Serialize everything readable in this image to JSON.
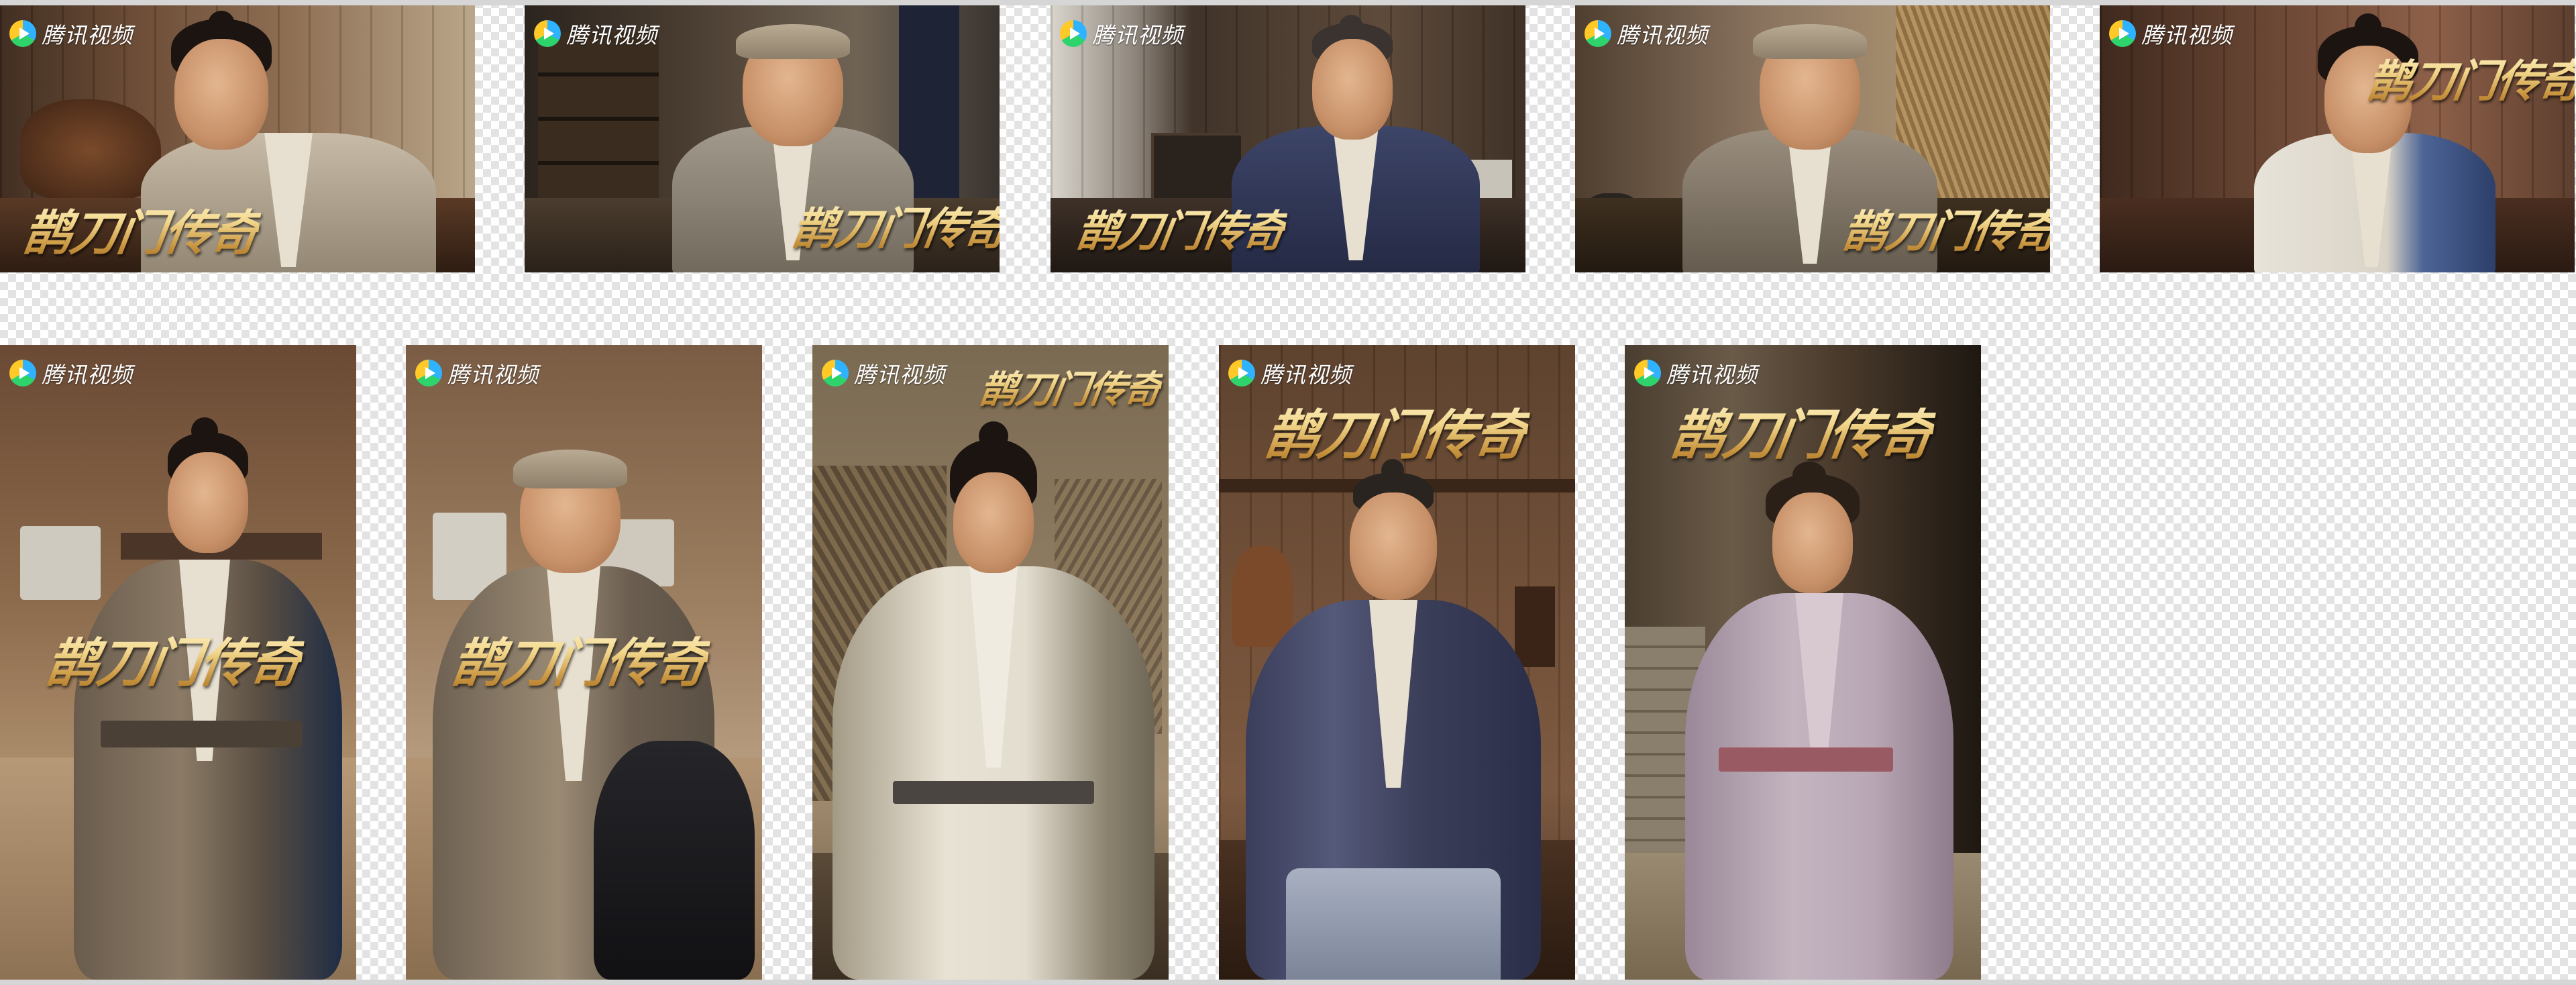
{
  "logo_text": "腾讯视频",
  "title_text": "鹊刀门传奇",
  "colors": {
    "checker_light": "#ffffff",
    "checker_dark": "#e3e3e3",
    "border": "#d6d6d6",
    "title_gold": "#e6c06b",
    "logo_blue": "#2fb3ff",
    "logo_green": "#2fd36b",
    "logo_yellow": "#ffc928"
  },
  "icons": {
    "logo": "tencent-video-play-icon"
  },
  "posters": [
    {
      "id": "landscape-1",
      "orientation": "landscape",
      "character": "smiling-man-topknot"
    },
    {
      "id": "landscape-2",
      "orientation": "landscape",
      "character": "man-headwrap"
    },
    {
      "id": "landscape-3",
      "orientation": "landscape",
      "character": "elder-man-seated"
    },
    {
      "id": "landscape-4",
      "orientation": "landscape",
      "character": "man-headwrap-tea"
    },
    {
      "id": "landscape-5",
      "orientation": "landscape",
      "character": "young-man-white-robe"
    },
    {
      "id": "portrait-1",
      "orientation": "portrait",
      "character": "man-topknot-standing"
    },
    {
      "id": "portrait-2",
      "orientation": "portrait",
      "character": "man-cap-with-bundle"
    },
    {
      "id": "portrait-3",
      "orientation": "portrait",
      "character": "young-man-bowing"
    },
    {
      "id": "portrait-4",
      "orientation": "portrait",
      "character": "elder-man-laughing"
    },
    {
      "id": "portrait-5",
      "orientation": "portrait",
      "character": "woman-lavender-robe"
    }
  ]
}
